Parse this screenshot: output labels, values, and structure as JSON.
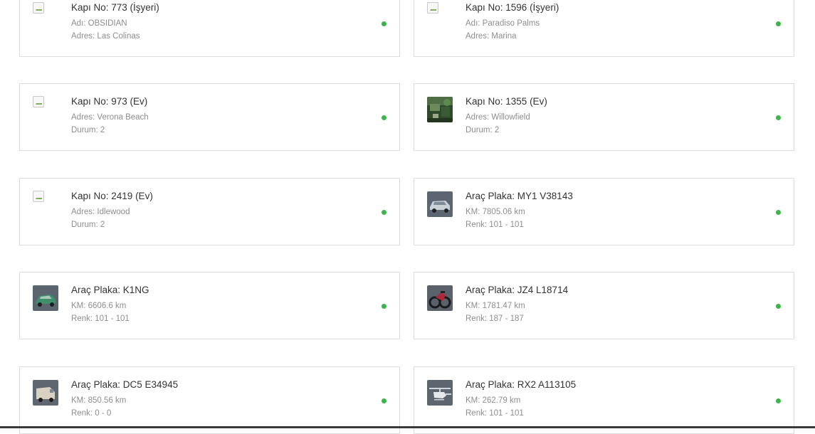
{
  "status_color": "#3cb44b",
  "cards": [
    {
      "title": "Kapı No: 773 (İşyeri)",
      "line1": "Adı: OBSIDIAN",
      "line2": "Adres: Las Colinas",
      "thumb": "broken-image-icon"
    },
    {
      "title": "Kapı No: 1596 (İşyeri)",
      "line1": "Adı: Paradiso Palms",
      "line2": "Adres: Marina",
      "thumb": "broken-image-icon"
    },
    {
      "title": "Kapı No: 973 (Ev)",
      "line1": "Adres: Verona Beach",
      "line2": "Durum: 2",
      "thumb": "broken-image-icon"
    },
    {
      "title": "Kapı No: 1355 (Ev)",
      "line1": "Adres: Willowfield",
      "line2": "Durum: 2",
      "thumb": "house-image"
    },
    {
      "title": "Kapı No: 2419 (Ev)",
      "line1": "Adres: Idlewood",
      "line2": "Durum: 2",
      "thumb": "broken-image-icon"
    },
    {
      "title": "Araç Plaka: MY1 V38143",
      "line1": "KM: 7805.06 km",
      "line2": "Renk: 101 - 101",
      "thumb": "car-image"
    },
    {
      "title": "Araç Plaka: K1NG",
      "line1": "KM: 6606.6 km",
      "line2": "Renk: 101 - 101",
      "thumb": "car-image"
    },
    {
      "title": "Araç Plaka: JZ4 L18714",
      "line1": "KM: 1781.47 km",
      "line2": "Renk: 187 - 187",
      "thumb": "bike-image"
    },
    {
      "title": "Araç Plaka: DC5 E34945",
      "line1": "KM: 850.56 km",
      "line2": "Renk: 0 - 0",
      "thumb": "van-image"
    },
    {
      "title": "Araç Plaka: RX2 A113105",
      "line1": "KM: 262.79 km",
      "line2": "Renk: 101 - 101",
      "thumb": "helicopter-image"
    }
  ]
}
